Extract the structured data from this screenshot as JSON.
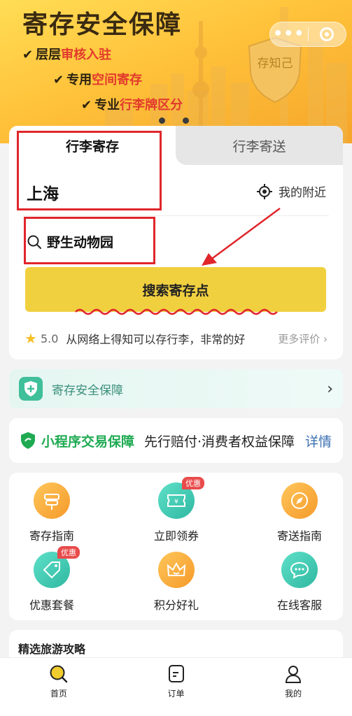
{
  "banner": {
    "title": "寄存安全保障",
    "features": [
      {
        "prefix": "层层",
        "highlight": "审核入驻"
      },
      {
        "prefix": "专用",
        "highlight": "空间寄存"
      },
      {
        "prefix": "专业",
        "highlight": "行李牌区分"
      }
    ],
    "shield_text": "存知己"
  },
  "capsule": {
    "more_label": "•••"
  },
  "search": {
    "tabs": [
      {
        "label": "行李寄存",
        "active": true
      },
      {
        "label": "行李寄送",
        "active": false
      }
    ],
    "city": "上海",
    "nearby_label": "我的附近",
    "keyword": "野生动物园",
    "button_label": "搜索寄存点"
  },
  "review": {
    "score": "5.0",
    "text": "从网络上得知可以存行李，非常的好",
    "more_label": "更多评价"
  },
  "safety": {
    "label": "寄存安全保障"
  },
  "guarantee": {
    "title": "小程序交易保障",
    "desc": "先行赔付·消费者权益保障",
    "link": "详情"
  },
  "services": [
    {
      "label": "寄存指南",
      "icon": "signpost-icon",
      "color": "#f5a93a",
      "badge": ""
    },
    {
      "label": "立即领券",
      "icon": "coupon-icon",
      "color": "#3fcab5",
      "badge": "优惠"
    },
    {
      "label": "寄送指南",
      "icon": "compass-icon",
      "color": "#f5a93a",
      "badge": ""
    },
    {
      "label": "优惠套餐",
      "icon": "tag-icon",
      "color": "#3fcab5",
      "badge": "优惠"
    },
    {
      "label": "积分好礼",
      "icon": "crown-icon",
      "color": "#f5a93a",
      "badge": ""
    },
    {
      "label": "在线客服",
      "icon": "chat-icon",
      "color": "#3fcab5",
      "badge": ""
    }
  ],
  "guides": {
    "title": "精选旅游攻略"
  },
  "tabbar": [
    {
      "label": "首页",
      "icon": "home-search-icon",
      "active": true
    },
    {
      "label": "订单",
      "icon": "order-icon",
      "active": false
    },
    {
      "label": "我的",
      "icon": "profile-icon",
      "active": false
    }
  ],
  "colors": {
    "accent_yellow": "#f1d040",
    "annotation_red": "#e0262b",
    "guarantee_green": "#1faa52"
  }
}
